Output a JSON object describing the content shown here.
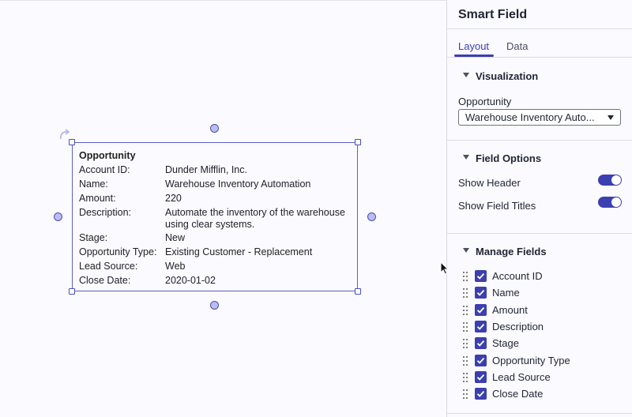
{
  "widget": {
    "title": "Opportunity",
    "rows": [
      {
        "label": "Account ID:",
        "value": "Dunder Mifflin, Inc."
      },
      {
        "label": "Name:",
        "value": "Warehouse Inventory Automation"
      },
      {
        "label": "Amount:",
        "value": "220"
      },
      {
        "label": "Description:",
        "value": "Automate the inventory of the warehouse using clear systems."
      },
      {
        "label": "Stage:",
        "value": "New"
      },
      {
        "label": "Opportunity Type:",
        "value": "Existing Customer - Replacement"
      },
      {
        "label": "Lead Source:",
        "value": "Web"
      },
      {
        "label": "Close Date:",
        "value": "2020-01-02"
      }
    ]
  },
  "panel": {
    "title": "Smart Field",
    "tabs": [
      {
        "label": "Layout",
        "active": true
      },
      {
        "label": "Data",
        "active": false
      }
    ],
    "visualization": {
      "heading": "Visualization",
      "object_label": "Opportunity",
      "selected_record": "Warehouse Inventory Auto..."
    },
    "field_options": {
      "heading": "Field Options",
      "options": [
        {
          "label": "Show Header",
          "enabled": true
        },
        {
          "label": "Show Field Titles",
          "enabled": true
        }
      ]
    },
    "manage_fields": {
      "heading": "Manage Fields",
      "fields": [
        {
          "label": "Account ID",
          "checked": true
        },
        {
          "label": "Name",
          "checked": true
        },
        {
          "label": "Amount",
          "checked": true
        },
        {
          "label": "Description",
          "checked": true
        },
        {
          "label": "Stage",
          "checked": true
        },
        {
          "label": "Opportunity Type",
          "checked": true
        },
        {
          "label": "Lead Source",
          "checked": true
        },
        {
          "label": "Close Date",
          "checked": true
        }
      ]
    }
  },
  "colors": {
    "accent": "#3b3fb0",
    "selection": "#5b60c0",
    "background": "#fbfaff"
  },
  "icons": {
    "rotate": "rotate-icon",
    "caret": "chevron-down-icon",
    "collapse": "triangle-down-icon",
    "drag": "drag-handle-icon",
    "check": "checkmark-icon",
    "cursor": "mouse-pointer-icon"
  }
}
